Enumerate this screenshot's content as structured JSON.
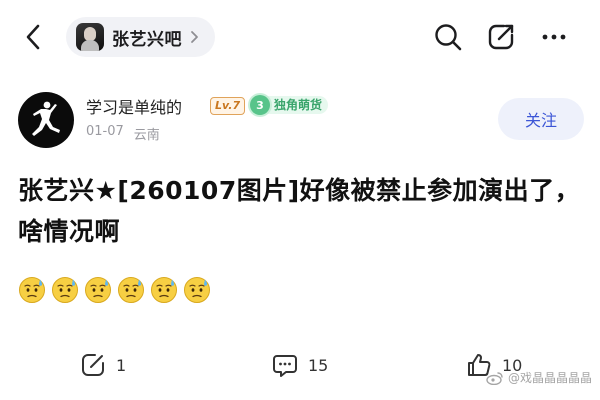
{
  "header": {
    "forum_name": "张艺兴吧"
  },
  "author": {
    "name": "学习是单纯的",
    "level": "Lv.7",
    "fan_level": "3",
    "fan_badge": "独角萌货",
    "date": "01-07",
    "location": "云南",
    "follow_label": "关注"
  },
  "post": {
    "title": "张艺兴★[260107图片]好像被禁止参加演出了，啥情况啊",
    "emoji_icons": [
      "worried-sweat-emoji",
      "worried-sweat-emoji",
      "worried-sweat-emoji",
      "worried-sweat-emoji",
      "worried-sweat-emoji",
      "worried-sweat-emoji"
    ]
  },
  "actions": {
    "reply_count": "1",
    "comment_count": "15",
    "like_count": "10"
  },
  "watermark": {
    "text": "@戏晶晶晶晶晶"
  },
  "colors": {
    "accent": "#3c56d6",
    "follow_bg": "#eef1fb",
    "fan_badge": "#3aa56c",
    "level_badge": "#c9771f"
  }
}
